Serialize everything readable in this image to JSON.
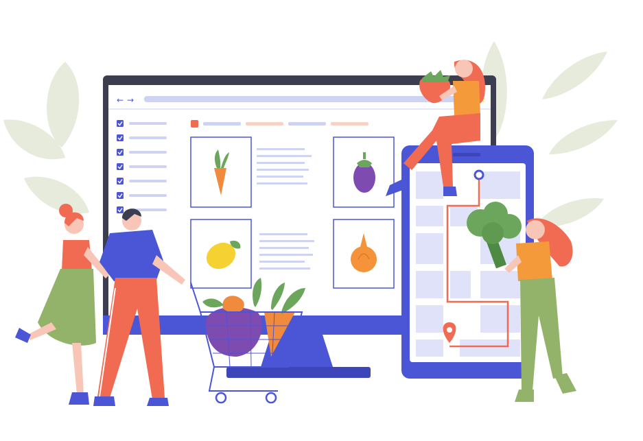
{
  "colors": {
    "background": "#ffffff",
    "leaf": "#e6ebdc",
    "monitor_frame": "#3d3d50",
    "monitor_base": "#4a56d6",
    "phone_body": "#4a56d6",
    "screen": "#ffffff",
    "ui_line": "#cfd3f2",
    "checkbox": "#4a56d6",
    "card_border": "#4a56d6",
    "coral": "#f06b52",
    "pink_skin": "#f7c6b6",
    "green_dress": "#93b36a",
    "blue_shirt": "#4a56d6",
    "orange_shirt": "#f59a3b",
    "route": "#f06b52",
    "map_block": "#dfe2f8"
  },
  "scene": {
    "products": [
      {
        "name": "carrot",
        "icon": "carrot-icon"
      },
      {
        "name": "eggplant",
        "icon": "eggplant-icon"
      },
      {
        "name": "lemon",
        "icon": "lemon-icon"
      },
      {
        "name": "onion",
        "icon": "onion-icon"
      }
    ],
    "checklist_count": 7,
    "people": [
      "woman-with-strawberry",
      "man-with-cart",
      "woman-hugging-man",
      "woman-with-broccoli"
    ],
    "cart_contents": [
      "eggplant",
      "carrot",
      "pepper",
      "greens"
    ]
  }
}
